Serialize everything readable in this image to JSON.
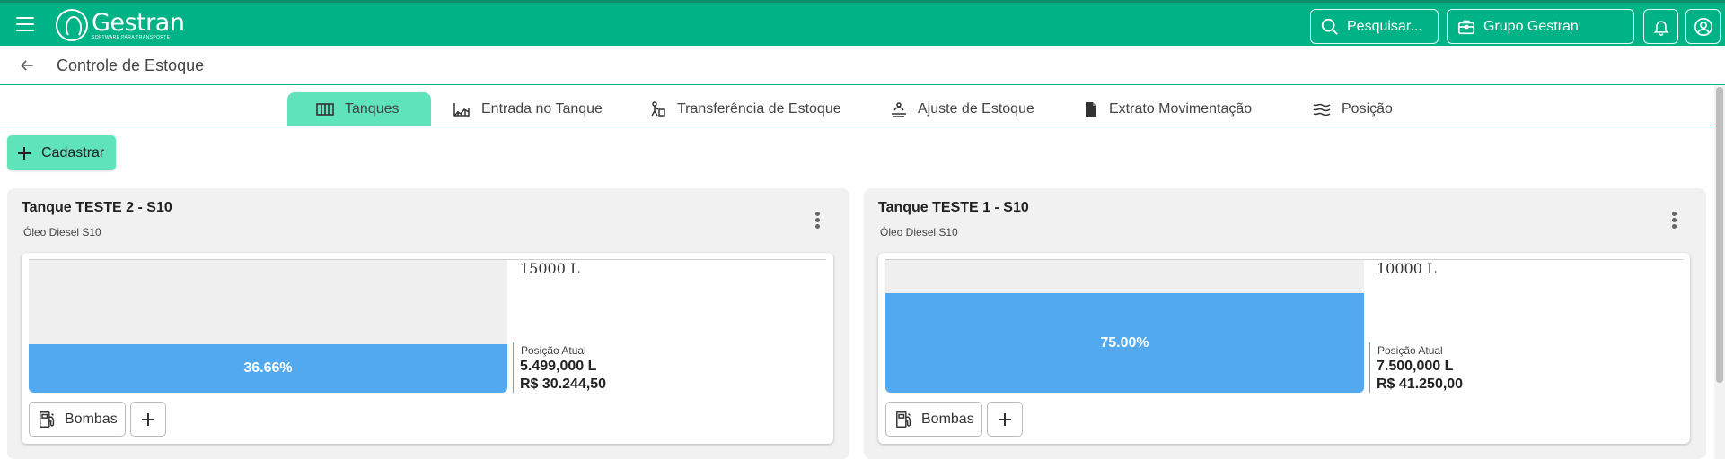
{
  "header": {
    "logo_name": "Gestran",
    "logo_tagline": "SOFTWARE PARA TRANSPORTE",
    "search_label": "Pesquisar...",
    "group_label": "Grupo Gestran"
  },
  "breadcrumb": {
    "title": "Controle de Estoque"
  },
  "tabs": [
    {
      "label": "Tanques",
      "icon": "tank-icon",
      "active": true
    },
    {
      "label": "Entrada no Tanque",
      "icon": "tank-entry-icon"
    },
    {
      "label": "Transferência de Estoque",
      "icon": "transfer-icon"
    },
    {
      "label": "Ajuste de Estoque",
      "icon": "adjust-icon"
    },
    {
      "label": "Extrato Movimentação",
      "icon": "document-icon"
    },
    {
      "label": "Posição",
      "icon": "waves-icon"
    }
  ],
  "actions": {
    "cadastrar_label": "Cadastrar"
  },
  "tanks": [
    {
      "name": "Tanque TESTE 2 - S10",
      "product": "Óleo Diesel S10",
      "capacity": "15000 L",
      "fill_percent": 36.66,
      "fill_label": "36.66%",
      "position_label": "Posição Atual",
      "volume": "5.499,000 L",
      "value": "R$ 30.244,50",
      "pumps_label": "Bombas"
    },
    {
      "name": "Tanque TESTE 1 - S10",
      "product": "Óleo Diesel S10",
      "capacity": "10000 L",
      "fill_percent": 75.0,
      "fill_label": "75.00%",
      "position_label": "Posição Atual",
      "volume": "7.500,000 L",
      "value": "R$ 41.250,00",
      "pumps_label": "Bombas"
    }
  ],
  "colors": {
    "primary": "#00b386",
    "tab_active": "#5fe3b8",
    "tank_fill": "#52a9f0"
  }
}
